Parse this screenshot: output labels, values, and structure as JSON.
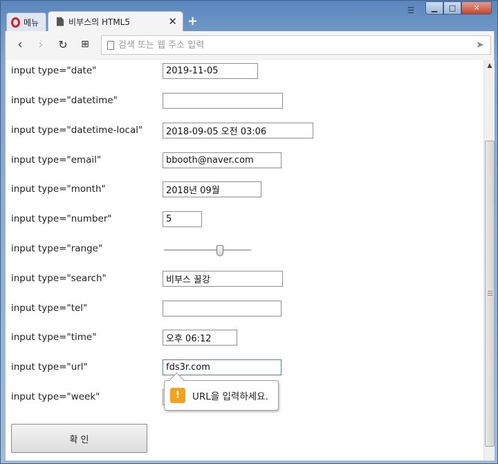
{
  "browser": {
    "menu_label": "메뉴",
    "tab_title": "비부스의 HTML5",
    "tab_close": "✕",
    "new_tab": "+",
    "address_placeholder": "검색 또는 웹 주소 입력"
  },
  "form": {
    "rows": [
      {
        "label": "input type=\"date\"",
        "value": "2019-11-05"
      },
      {
        "label": "input type=\"datetime\"",
        "value": ""
      },
      {
        "label": "input type=\"datetime-local\"",
        "value": "2018-09-05 오전 03:06"
      },
      {
        "label": "input type=\"email\"",
        "value": "bbooth@naver.com"
      },
      {
        "label": "input type=\"month\"",
        "value": "2018년 09월"
      },
      {
        "label": "input type=\"number\"",
        "value": "5"
      },
      {
        "label": "input type=\"range\"",
        "value": 0.65
      },
      {
        "label": "input type=\"search\"",
        "value": "비부스 꿀강"
      },
      {
        "label": "input type=\"tel\"",
        "value": ""
      },
      {
        "label": "input type=\"time\"",
        "value": "오후 06:12"
      },
      {
        "label": "input type=\"url\"",
        "value": "fds3r.com"
      },
      {
        "label": "input type=\"week\"",
        "value": ""
      }
    ],
    "validation_message": "URL을 입력하세요.",
    "submit_label": "확 인"
  }
}
